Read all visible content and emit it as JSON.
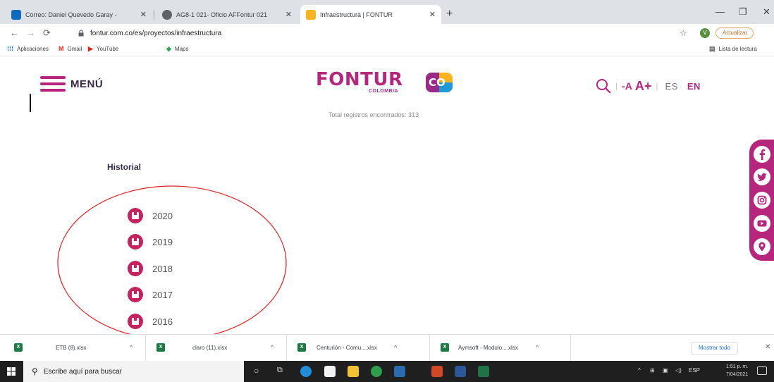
{
  "browser": {
    "tabs": [
      {
        "title": "Correo: Daniel Quevedo Garay - ",
        "favicon_color": "#0f6cbd",
        "active": false
      },
      {
        "title": "AG8-1 021- Oficio AFFontur 021",
        "favicon_color": "#5f6368",
        "active": false
      },
      {
        "title": "Infraestructura | FONTUR",
        "favicon_color": "#f7b41c",
        "active": true
      }
    ],
    "url": "fontur.com.co/es/proyectos/infraestructura",
    "profile_initial": "V",
    "update_label": "Actualizar",
    "bookmarks": [
      {
        "label": "Aplicaciones",
        "icon": "apps-grid-icon"
      },
      {
        "label": "Gmail",
        "icon": "gmail-icon"
      },
      {
        "label": "YouTube",
        "icon": "youtube-icon"
      },
      {
        "label": "Maps",
        "icon": "maps-icon"
      }
    ],
    "reading_list_label": "Lista de lectura"
  },
  "site": {
    "menu_label": "MENÚ",
    "logo_text": "FONTUR",
    "logo_subtext": "COLOMBIA",
    "logo_badge": "CO",
    "font_minus": "-A",
    "font_plus": "A+",
    "lang_es": "ES",
    "lang_en": "EN",
    "total_records": "Total registros encontrados: 313",
    "history_title": "Historial",
    "years": [
      "2020",
      "2019",
      "2018",
      "2017",
      "2016"
    ],
    "accent_color": "#b7267d",
    "social": [
      "facebook-icon",
      "twitter-icon",
      "instagram-icon",
      "youtube-icon",
      "location-pin-icon"
    ]
  },
  "downloads": {
    "items": [
      "ETB (8).xlsx",
      "claro (11).xlsx",
      "Centurión - Comu....xlsx",
      "Aymsoft - Modulo....xlsx"
    ],
    "show_all": "Mostrar todo"
  },
  "taskbar": {
    "search_placeholder": "Escribe aquí para buscar",
    "language": "ESP",
    "time": "1:51 p. m.",
    "date": "7/04/2021"
  }
}
